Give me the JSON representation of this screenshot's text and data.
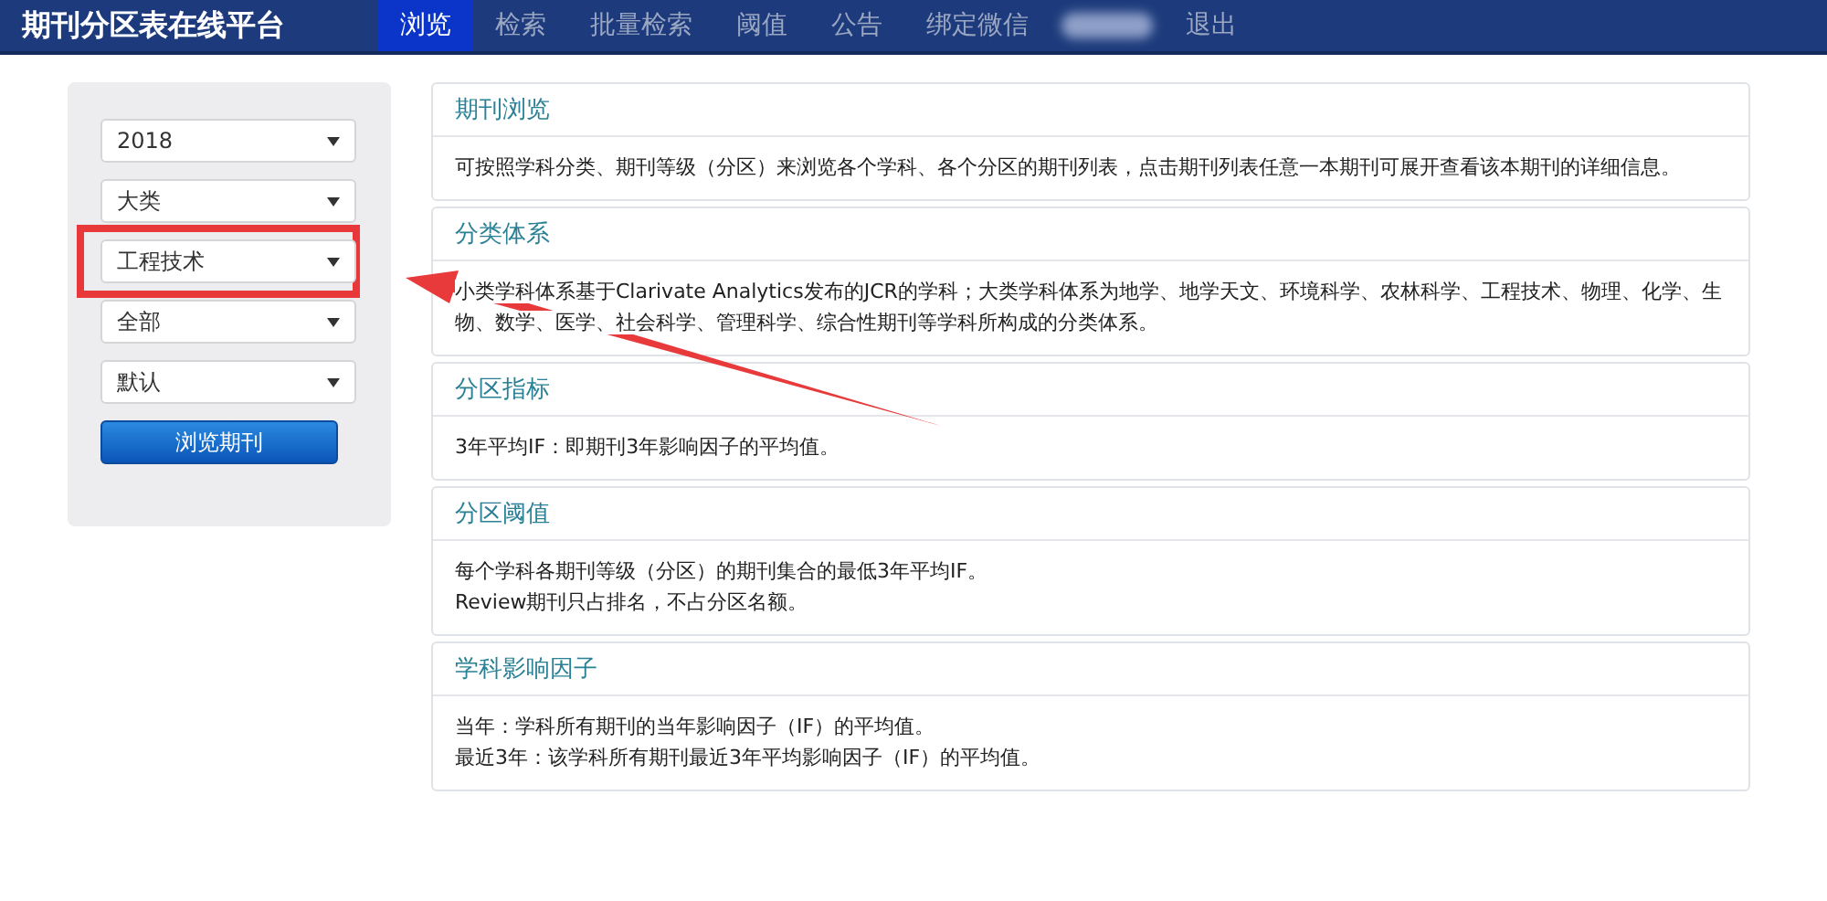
{
  "brand": "期刊分区表在线平台",
  "nav": [
    {
      "label": "浏览",
      "selected": true
    },
    {
      "label": "检索",
      "selected": false
    },
    {
      "label": "批量检索",
      "selected": false
    },
    {
      "label": "阈值",
      "selected": false
    },
    {
      "label": "公告",
      "selected": false
    },
    {
      "label": "绑定微信",
      "selected": false
    },
    {
      "kind": "blurred"
    },
    {
      "label": "退出",
      "selected": false
    }
  ],
  "filters": [
    {
      "value": "2018",
      "highlighted": false
    },
    {
      "value": "大类",
      "highlighted": false
    },
    {
      "value": "工程技术",
      "highlighted": true
    },
    {
      "value": "全部",
      "highlighted": false
    },
    {
      "value": "默认",
      "highlighted": false
    }
  ],
  "browse_button": "浏览期刊",
  "cards": [
    {
      "title": "期刊浏览",
      "lines": [
        "可按照学科分类、期刊等级（分区）来浏览各个学科、各个分区的期刊列表，点击期刊列表任意一本期刊可展开查看该本期刊的详细信息。"
      ]
    },
    {
      "title": "分类体系",
      "lines": [
        "小类学科体系基于Clarivate Analytics发布的JCR的学科；大类学科体系为地学、地学天文、环境科学、农林科学、工程技术、物理、化学、生物、数学、医学、社会科学、管理科学、综合性期刊等学科所构成的分类体系。"
      ]
    },
    {
      "title": "分区指标",
      "lines": [
        "3年平均IF：即期刊3年影响因子的平均值。"
      ]
    },
    {
      "title": "分区阈值",
      "lines": [
        "每个学科各期刊等级（分区）的期刊集合的最低3年平均IF。",
        "Review期刊只占排名，不占分区名额。"
      ]
    },
    {
      "title": "学科影响因子",
      "lines": [
        "当年：学科所有期刊的当年影响因子（IF）的平均值。",
        "最近3年：该学科所有期刊最近3年平均影响因子（IF）的平均值。"
      ]
    }
  ]
}
